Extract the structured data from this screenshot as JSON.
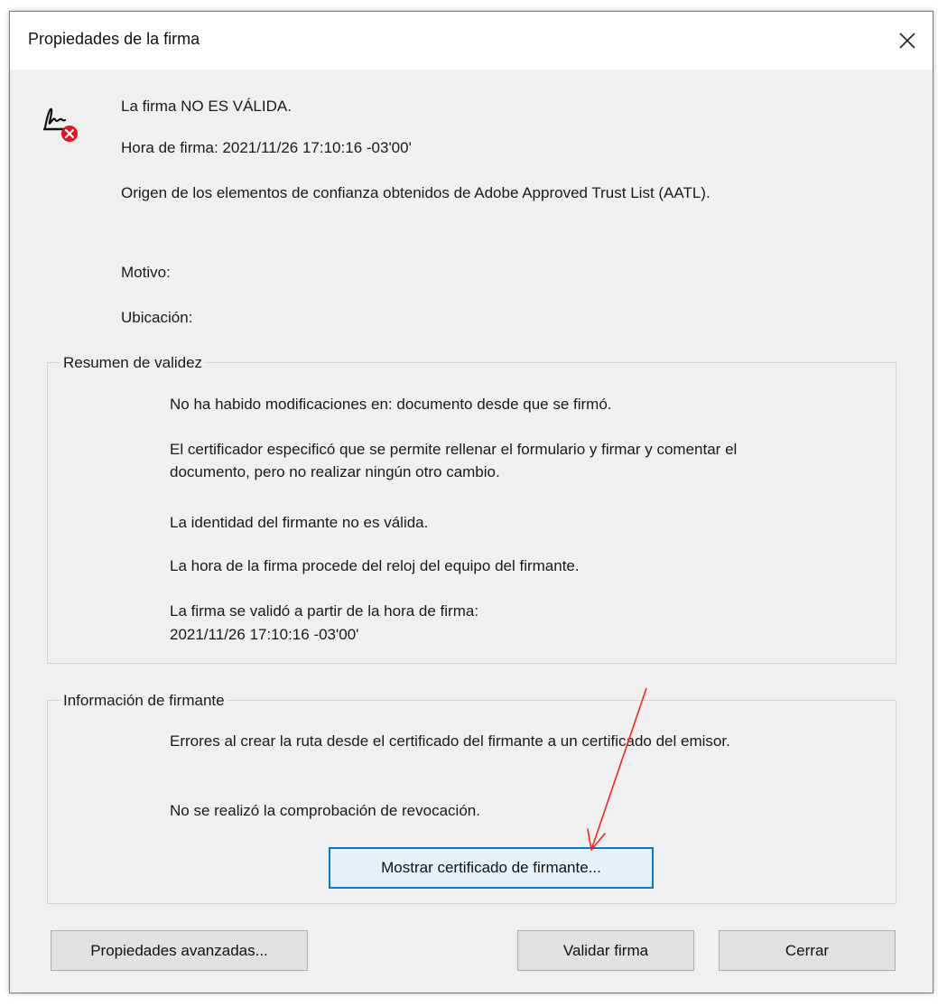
{
  "dialog": {
    "title": "Propiedades de la firma",
    "close_label": "×"
  },
  "summary": {
    "status": "La firma NO ES VÁLIDA.",
    "signing_time": "Hora de firma:  2021/11/26 17:10:16 -03'00'",
    "trust_source": "Origen de los elementos de confianza obtenidos de Adobe Approved Trust List (AATL).",
    "reason_label": "Motivo:",
    "location_label": "Ubicación:"
  },
  "validity": {
    "legend": "Resumen de validez",
    "lines": [
      "No ha habido modificaciones en: documento desde que se firmó.",
      "El certificador especificó que se permite rellenar el formulario y firmar y comentar el documento, pero no realizar ningún otro cambio.",
      "La identidad del firmante no es válida.",
      "La hora de la firma procede del reloj del equipo del firmante.",
      "La firma se validó a partir de la hora de firma:",
      "2021/11/26 17:10:16 -03'00'"
    ]
  },
  "signer": {
    "legend": "Información de firmante",
    "lines": [
      "Errores al crear la ruta desde el certificado del firmante a un certificado del emisor.",
      "No se realizó la comprobación de revocación."
    ],
    "show_cert_button": "Mostrar certificado de firmante..."
  },
  "buttons": {
    "advanced": "Propiedades avanzadas...",
    "validate": "Validar firma",
    "close": "Cerrar"
  },
  "colors": {
    "error_badge": "#e81123",
    "focus_border": "#0078d7",
    "annotation_arrow": "#ff2020"
  },
  "icons": {
    "signature": "signature-error-icon",
    "close": "close-icon"
  }
}
